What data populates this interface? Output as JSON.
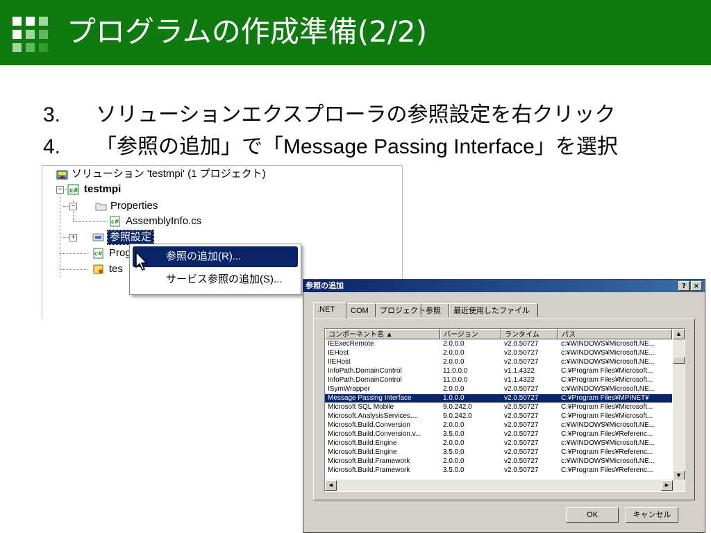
{
  "header": {
    "title": "プログラムの作成準備(2/2)"
  },
  "steps": [
    {
      "num": "3.",
      "text": "ソリューションエクスプローラの参照設定を右クリック"
    },
    {
      "num": "4.",
      "text": "「参照の追加」で「Message Passing Interface」を選択"
    }
  ],
  "explorer": {
    "solution_label": "ソリューション 'testmpi' (1 プロジェクト)",
    "project_label": "testmpi",
    "properties_label": "Properties",
    "assemblyinfo_label": "AssemblyInfo.cs",
    "references_label": "参照設定",
    "program_label": "Prog",
    "test_label": "tes"
  },
  "context_menu": {
    "items": [
      {
        "label": "参照の追加(R)..."
      },
      {
        "label": "サービス参照の追加(S)..."
      }
    ]
  },
  "dialog": {
    "title": "参照の追加",
    "help_button": "?",
    "close_button": "×",
    "tabs": [
      ".NET",
      "COM",
      "プロジェクト",
      "参照",
      "最近使用したファイル"
    ],
    "columns": [
      "コンポーネント名 ▲",
      "バージョン",
      "ランタイム",
      "パス"
    ],
    "rows": [
      {
        "name": "IEExecRemote",
        "version": "2.0.0.0",
        "runtime": "v2.0.50727",
        "path": "c:¥WINDOWS¥Microsoft.NE..."
      },
      {
        "name": "IEHost",
        "version": "2.0.0.0",
        "runtime": "v2.0.50727",
        "path": "c:¥WINDOWS¥Microsoft.NE..."
      },
      {
        "name": "IIEHost",
        "version": "2.0.0.0",
        "runtime": "v2.0.50727",
        "path": "c:¥WINDOWS¥Microsoft.NE..."
      },
      {
        "name": "InfoPath.DomainControl",
        "version": "11.0.0.0",
        "runtime": "v1.1.4322",
        "path": "C:¥Program Files¥Microsoft..."
      },
      {
        "name": "InfoPath.DomainControl",
        "version": "11.0.0.0",
        "runtime": "v1.1.4322",
        "path": "C:¥Program Files¥Microsoft..."
      },
      {
        "name": "ISymWrapper",
        "version": "2.0.0.0",
        "runtime": "v2.0.50727",
        "path": "c:¥WINDOWS¥Microsoft.NE..."
      },
      {
        "name": "Message Passing Interface",
        "version": "1.0.0.0",
        "runtime": "v2.0.50727",
        "path": "C:¥Program Files¥MPINET¥"
      },
      {
        "name": "Microsoft SQL Mobile",
        "version": "9.0.242.0",
        "runtime": "v2.0.50727",
        "path": "C:¥Program Files¥Microsoft..."
      },
      {
        "name": "Microsoft.AnalysisServices....",
        "version": "9.0.242.0",
        "runtime": "v2.0.50727",
        "path": "C:¥Program Files¥Microsoft..."
      },
      {
        "name": "Microsoft.Build.Conversion",
        "version": "2.0.0.0",
        "runtime": "v2.0.50727",
        "path": "c:¥WINDOWS¥Microsoft.NE..."
      },
      {
        "name": "Microsoft.Build.Conversion.v...",
        "version": "3.5.0.0",
        "runtime": "v2.0.50727",
        "path": "C:¥Program Files¥Referenc..."
      },
      {
        "name": "Microsoft.Build.Engine",
        "version": "2.0.0.0",
        "runtime": "v2.0.50727",
        "path": "c:¥WINDOWS¥Microsoft.NE..."
      },
      {
        "name": "Microsoft.Build.Engine",
        "version": "3.5.0.0",
        "runtime": "v2.0.50727",
        "path": "C:¥Program Files¥Referenc..."
      },
      {
        "name": "Microsoft.Build.Framework",
        "version": "2.0.0.0",
        "runtime": "v2.0.50727",
        "path": "c:¥WINDOWS¥Microsoft.NE..."
      },
      {
        "name": "Microsoft.Build.Framework",
        "version": "3.5.0.0",
        "runtime": "v2.0.50727",
        "path": "C:¥Program Files¥Referenc..."
      }
    ],
    "selected_row": 6,
    "ok_label": "OK",
    "cancel_label": "キャンセル"
  },
  "colors": {
    "header_bg": "#0f7a0f",
    "selection": "#0a246a",
    "dialog_face": "#d4d0c8"
  }
}
